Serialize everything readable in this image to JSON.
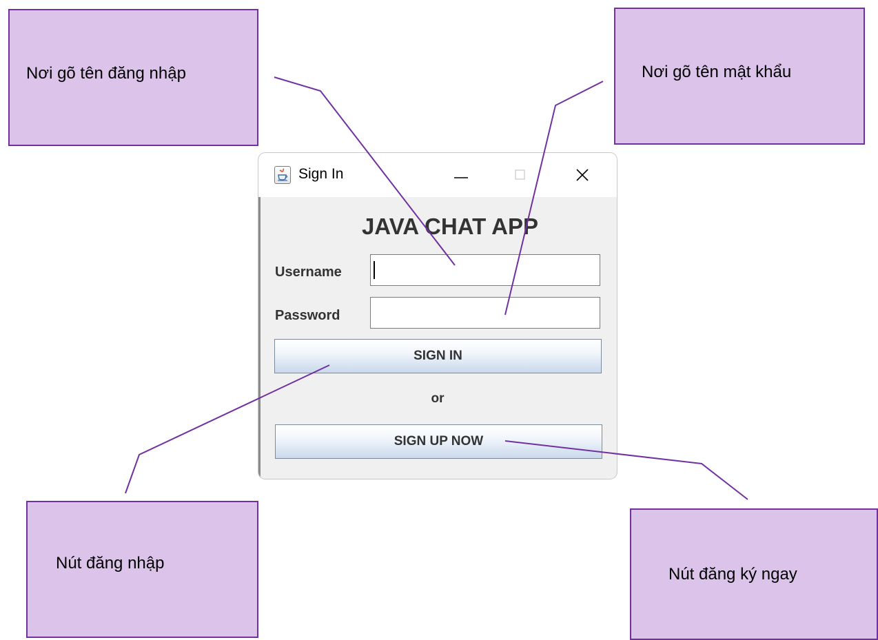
{
  "callouts": {
    "username": "Nơi gõ tên đăng nhập",
    "password": "Nơi gõ tên mật khẩu",
    "sign_in": "Nút đăng nhập",
    "sign_up": "Nút đăng ký ngay"
  },
  "window": {
    "title": "Sign In",
    "app_title": "JAVA CHAT APP",
    "username_label": "Username",
    "password_label": "Password",
    "username_value": "",
    "password_value": "",
    "sign_in_label": "SIGN IN",
    "or_label": "or",
    "sign_up_label": "SIGN UP NOW"
  },
  "colors": {
    "callout_fill": "#dcc3ea",
    "callout_border": "#7030a0",
    "connector": "#7030a0"
  },
  "icons": {
    "app": "java-cup-icon",
    "minimize": "minimize-icon",
    "maximize": "maximize-icon",
    "close": "close-icon"
  }
}
